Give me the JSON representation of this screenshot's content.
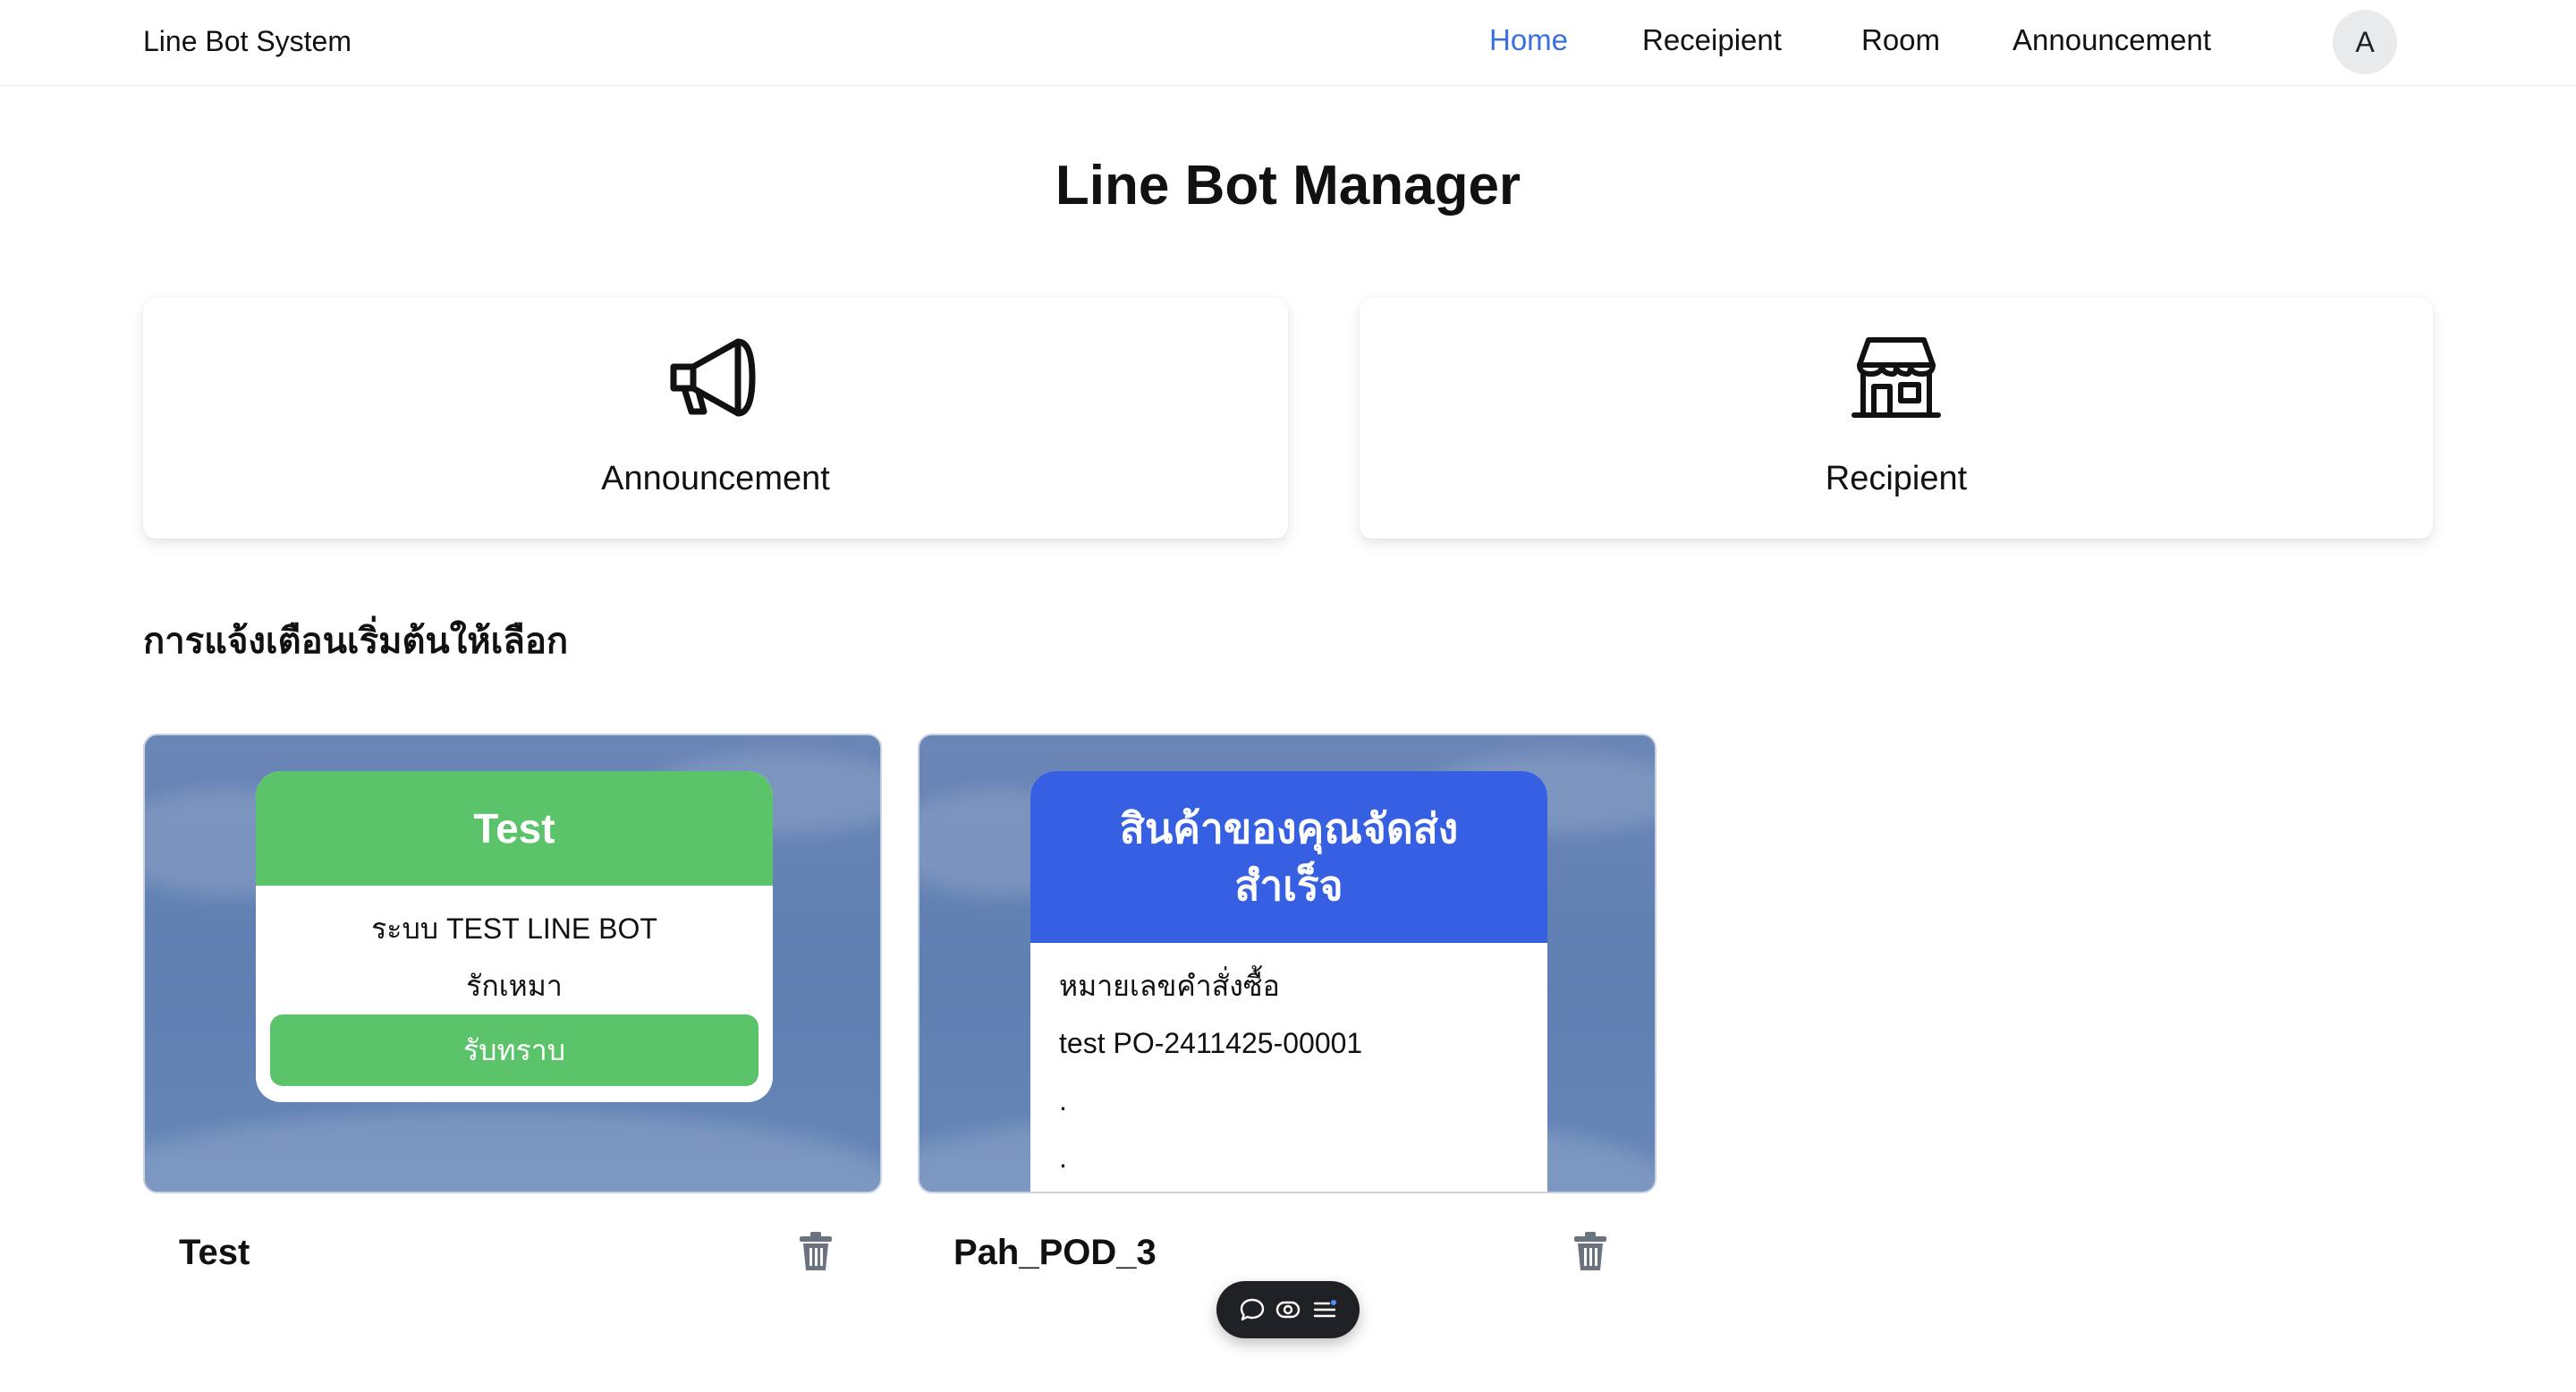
{
  "navbar": {
    "brand": "Line Bot System",
    "links": [
      {
        "label": "Home",
        "active": true
      },
      {
        "label": "Receipient",
        "active": false
      },
      {
        "label": "Room",
        "active": false
      },
      {
        "label": "Announcement",
        "active": false
      }
    ],
    "avatar_initial": "A",
    "accent_color": "#3b6fe0"
  },
  "page": {
    "title": "Line Bot Manager"
  },
  "nav_cards": [
    {
      "label": "Announcement",
      "icon": "megaphone-icon"
    },
    {
      "label": "Recipient",
      "icon": "storefront-icon"
    }
  ],
  "section": {
    "heading": "การแจ้งเตือนเริ่มต้นให้เลือก"
  },
  "templates": [
    {
      "name": "Test",
      "header": "Test",
      "header_color": "#5bc36a",
      "lines": [
        "ระบบ TEST LINE BOT",
        "รักเหมา"
      ],
      "button": "รับทราบ",
      "button_color": "#5bc36a"
    },
    {
      "name": "Pah_POD_3",
      "header": "สินค้าของคุณจัดส่งสำเร็จ",
      "header_color": "#3660e1",
      "lines": [
        "หมายเลขคำสั่งซื้อ",
        "test PO-2411425-00001",
        ".",
        "."
      ]
    }
  ],
  "floating_toolbar": {
    "icons": [
      "comment-icon",
      "eye-icon",
      "list-icon"
    ]
  }
}
